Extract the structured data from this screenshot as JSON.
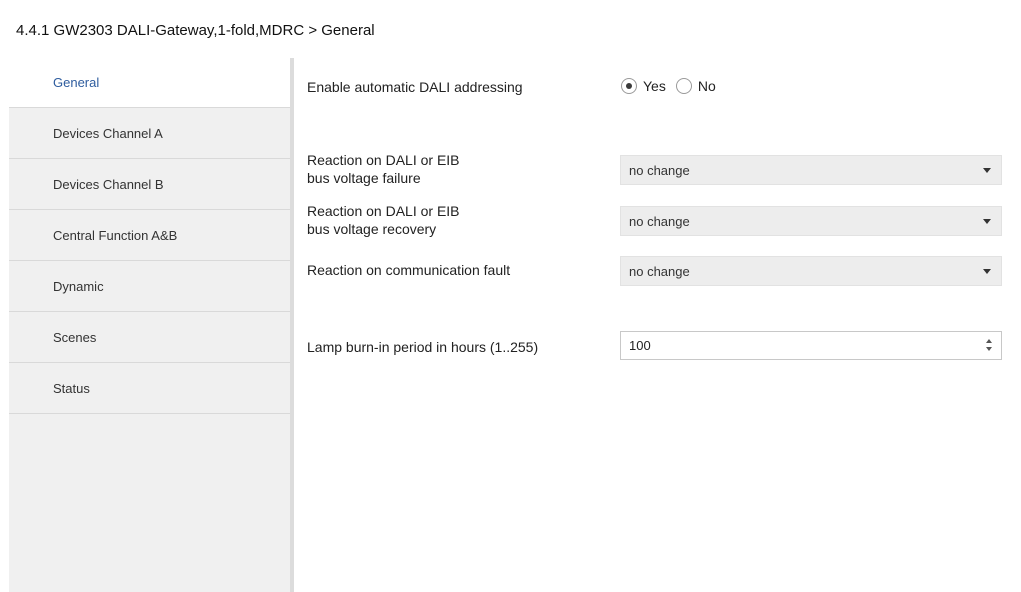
{
  "window": {
    "title": "4.4.1 GW2303 DALI-Gateway,1-fold,MDRC > General"
  },
  "sidebar": {
    "items": [
      {
        "label": "General",
        "active": true
      },
      {
        "label": "Devices Channel A"
      },
      {
        "label": "Devices Channel B"
      },
      {
        "label": "Central Function A&B"
      },
      {
        "label": "Dynamic"
      },
      {
        "label": "Scenes"
      },
      {
        "label": "Status"
      }
    ]
  },
  "params": {
    "auto_addressing": {
      "label": "Enable automatic DALI addressing",
      "options": [
        "Yes",
        "No"
      ],
      "selected": "Yes"
    },
    "voltage_failure": {
      "label_line1": "Reaction on DALI or EIB",
      "label_line2": "bus voltage failure",
      "value": "no change"
    },
    "voltage_recovery": {
      "label_line1": "Reaction on DALI or EIB",
      "label_line2": "bus voltage recovery",
      "value": "no change"
    },
    "communication_fault": {
      "label": "Reaction on communication fault",
      "value": "no change"
    },
    "burn_in_period": {
      "label": "Lamp burn-in period in hours (1..255)",
      "value": "100"
    }
  },
  "colors": {
    "active_item_text": "#2e5c9e",
    "sidebar_bg": "#f0f0f0",
    "dropdown_bg": "#ededed"
  }
}
